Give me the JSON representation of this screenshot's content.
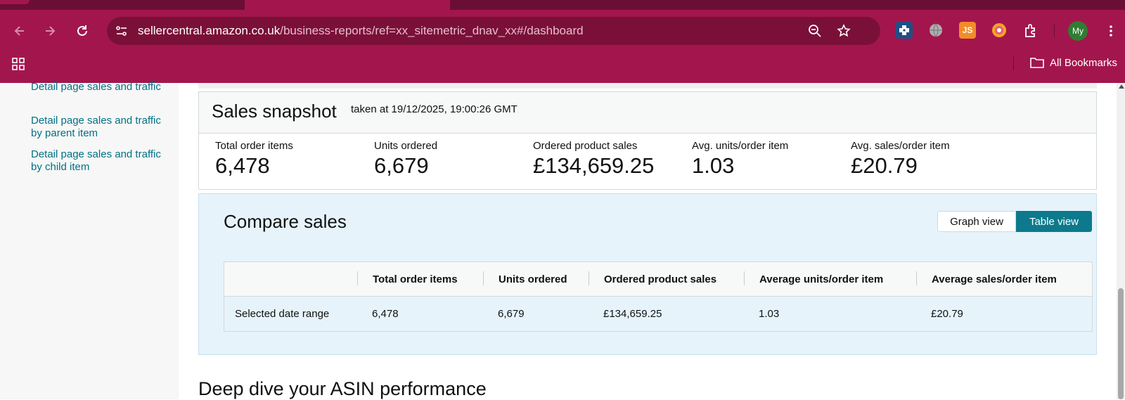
{
  "browser": {
    "url_host": "sellercentral.amazon.co.uk",
    "url_path": "/business-reports/ref=xx_sitemetric_dnav_xx#/dashboard",
    "profile_initials": "My",
    "all_bookmarks_label": "All Bookmarks",
    "extensions": [
      "puzzle-extension-icon",
      "globe-icon",
      "js-icon",
      "chrome-color-icon",
      "extensions-icon"
    ],
    "theme_color": "#a3164d"
  },
  "sidebar": {
    "items": [
      {
        "label": "Detail page sales and traffic"
      },
      {
        "label": "Detail page sales and traffic by parent item"
      },
      {
        "label": "Detail page sales and traffic by child item"
      }
    ],
    "link_color": "#007185"
  },
  "snapshot": {
    "title": "Sales snapshot",
    "taken_at": "taken at 19/12/2025, 19:00:26 GMT",
    "metrics": [
      {
        "label": "Total order items",
        "value": "6,478"
      },
      {
        "label": "Units ordered",
        "value": "6,679"
      },
      {
        "label": "Ordered product sales",
        "value": "£134,659.25"
      },
      {
        "label": "Avg. units/order item",
        "value": "1.03"
      },
      {
        "label": "Avg. sales/order item",
        "value": "£20.79"
      }
    ]
  },
  "compare": {
    "title": "Compare sales",
    "graph_view_label": "Graph view",
    "table_view_label": "Table view",
    "active_view": "Table view",
    "columns": [
      "Total order items",
      "Units ordered",
      "Ordered product sales",
      "Average units/order item",
      "Average sales/order item"
    ],
    "rows": [
      {
        "label": "Selected date range",
        "values": [
          "6,478",
          "6,679",
          "£134,659.25",
          "1.03",
          "£20.79"
        ]
      }
    ],
    "accent_color": "#0c7a8c"
  },
  "deep_dive": {
    "title": "Deep dive your ASIN performance"
  }
}
